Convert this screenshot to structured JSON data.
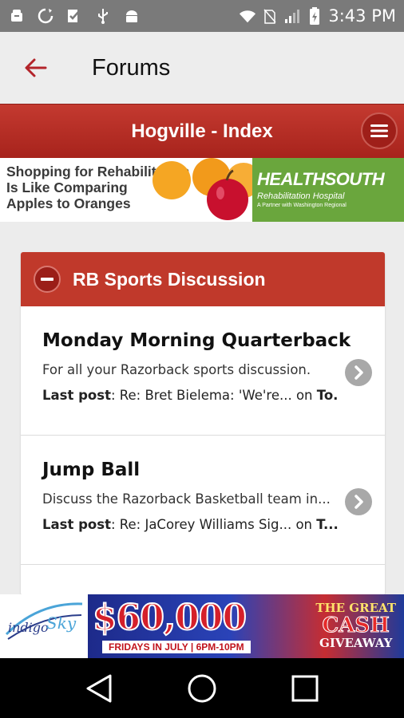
{
  "status_bar": {
    "time": "3:43 PM",
    "left_icons": [
      "android-debug-icon",
      "sync-icon",
      "task-check-icon",
      "usb-icon",
      "android-icon"
    ],
    "right_icons": [
      "wifi-icon",
      "no-sim-icon",
      "signal-icon",
      "battery-icon"
    ]
  },
  "app_bar": {
    "title": "Forums",
    "back_icon": "arrow-left-icon"
  },
  "forum_header": {
    "title": "Hogville - Index",
    "menu_icon": "hamburger-menu-icon"
  },
  "ad_top": {
    "line1": "Shopping for Rehabilitation",
    "line2": "Is Like Comparing",
    "line3": "Apples to Oranges",
    "brand": "HEALTHSOUTH",
    "brand_sub": "Rehabilitation Hospital",
    "brand_partner": "A Partner with Washington Regional"
  },
  "section": {
    "title": "RB Sports Discussion",
    "collapse_icon": "minus-icon"
  },
  "forums": [
    {
      "title": "Monday Morning Quarterback",
      "description": "For all your Razorback sports discussion.",
      "last_post_label": "Last post",
      "last_post_text": ": Re: Bret Bielema: 'We're... on ",
      "last_post_topic": "To..."
    },
    {
      "title": "Jump Ball",
      "description": "Discuss the Razorback Basketball team in...",
      "last_post_label": "Last post",
      "last_post_text": ": Re: JaCorey Williams Sig... on ",
      "last_post_topic": "T..."
    }
  ],
  "ad_bottom": {
    "logo_indigo": "indigo",
    "logo_sky": "Sky",
    "prize": "$60,000",
    "prize_sub": "FRIDAYS IN JULY | 6PM-10PM",
    "giveaway_1": "THE GREAT",
    "giveaway_2": "CASH",
    "giveaway_3": "GIVEAWAY"
  },
  "nav_bar": {
    "back_icon": "nav-back-icon",
    "home_icon": "nav-home-icon",
    "recents_icon": "nav-recents-icon"
  },
  "colors": {
    "accent_red": "#c0392b",
    "status_bar": "#7a7a7a",
    "healthsouth_green": "#6aa63d"
  }
}
